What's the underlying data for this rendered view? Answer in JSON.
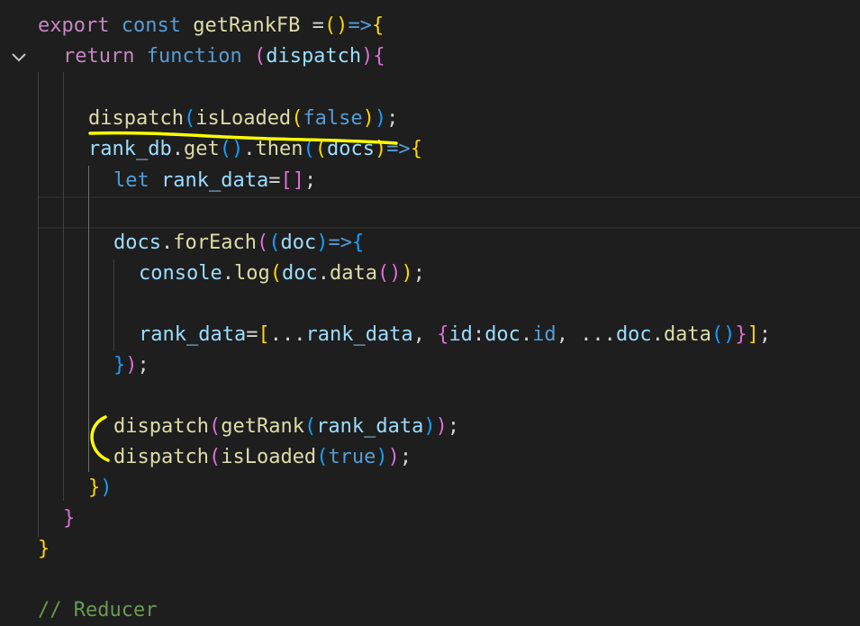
{
  "editor": {
    "lines": [
      {
        "tokens": [
          {
            "t": "export",
            "c": "kw"
          },
          {
            "t": " ",
            "c": "pun"
          },
          {
            "t": "const",
            "c": "kw2"
          },
          {
            "t": " ",
            "c": "pun"
          },
          {
            "t": "getRankFB",
            "c": "fn"
          },
          {
            "t": " =",
            "c": "pun"
          },
          {
            "t": "()",
            "c": "br1"
          },
          {
            "t": "=>",
            "c": "kw2"
          },
          {
            "t": "{",
            "c": "br1"
          }
        ]
      },
      {
        "tokens": [
          {
            "t": "return",
            "c": "kw"
          },
          {
            "t": " ",
            "c": "pun"
          },
          {
            "t": "function",
            "c": "kw2"
          },
          {
            "t": " ",
            "c": "pun"
          },
          {
            "t": "(",
            "c": "br2"
          },
          {
            "t": "dispatch",
            "c": "id"
          },
          {
            "t": ")",
            "c": "br2"
          },
          {
            "t": "{",
            "c": "br2"
          }
        ]
      },
      {
        "tokens": []
      },
      {
        "tokens": [
          {
            "t": "dispatch",
            "c": "fn"
          },
          {
            "t": "(",
            "c": "br3"
          },
          {
            "t": "isLoaded",
            "c": "fn"
          },
          {
            "t": "(",
            "c": "br1"
          },
          {
            "t": "false",
            "c": "kw2"
          },
          {
            "t": ")",
            "c": "br1"
          },
          {
            "t": ")",
            "c": "br3"
          },
          {
            "t": ";",
            "c": "pun"
          }
        ]
      },
      {
        "tokens": [
          {
            "t": "rank_db",
            "c": "id"
          },
          {
            "t": ".",
            "c": "pun"
          },
          {
            "t": "get",
            "c": "fn"
          },
          {
            "t": "()",
            "c": "br3"
          },
          {
            "t": ".",
            "c": "pun"
          },
          {
            "t": "then",
            "c": "fn"
          },
          {
            "t": "(",
            "c": "br3"
          },
          {
            "t": "(",
            "c": "br1"
          },
          {
            "t": "docs",
            "c": "id"
          },
          {
            "t": ")",
            "c": "br1"
          },
          {
            "t": "=>",
            "c": "kw2"
          },
          {
            "t": "{",
            "c": "br1"
          }
        ]
      },
      {
        "tokens": [
          {
            "t": "let",
            "c": "kw2"
          },
          {
            "t": " ",
            "c": "pun"
          },
          {
            "t": "rank_data",
            "c": "id"
          },
          {
            "t": "=",
            "c": "pun"
          },
          {
            "t": "[]",
            "c": "br2"
          },
          {
            "t": ";",
            "c": "pun"
          }
        ]
      },
      {
        "tokens": []
      },
      {
        "tokens": [
          {
            "t": "docs",
            "c": "id"
          },
          {
            "t": ".",
            "c": "pun"
          },
          {
            "t": "forEach",
            "c": "fn"
          },
          {
            "t": "(",
            "c": "br2"
          },
          {
            "t": "(",
            "c": "br3"
          },
          {
            "t": "doc",
            "c": "id"
          },
          {
            "t": ")",
            "c": "br3"
          },
          {
            "t": "=>",
            "c": "kw2"
          },
          {
            "t": "{",
            "c": "br3"
          }
        ]
      },
      {
        "tokens": [
          {
            "t": "console",
            "c": "id"
          },
          {
            "t": ".",
            "c": "pun"
          },
          {
            "t": "log",
            "c": "fn"
          },
          {
            "t": "(",
            "c": "br1"
          },
          {
            "t": "doc",
            "c": "id"
          },
          {
            "t": ".",
            "c": "pun"
          },
          {
            "t": "data",
            "c": "fn"
          },
          {
            "t": "()",
            "c": "br2"
          },
          {
            "t": ")",
            "c": "br1"
          },
          {
            "t": ";",
            "c": "pun"
          }
        ]
      },
      {
        "tokens": []
      },
      {
        "tokens": [
          {
            "t": "rank_data",
            "c": "id"
          },
          {
            "t": "=",
            "c": "pun"
          },
          {
            "t": "[",
            "c": "br1"
          },
          {
            "t": "...",
            "c": "pun"
          },
          {
            "t": "rank_data",
            "c": "id"
          },
          {
            "t": ", ",
            "c": "pun"
          },
          {
            "t": "{",
            "c": "br2"
          },
          {
            "t": "id",
            "c": "id"
          },
          {
            "t": ":",
            "c": "pun"
          },
          {
            "t": "doc",
            "c": "id"
          },
          {
            "t": ".",
            "c": "pun"
          },
          {
            "t": "id",
            "c": "kw2"
          },
          {
            "t": ", ",
            "c": "pun"
          },
          {
            "t": "...",
            "c": "pun"
          },
          {
            "t": "doc",
            "c": "id"
          },
          {
            "t": ".",
            "c": "pun"
          },
          {
            "t": "data",
            "c": "fn"
          },
          {
            "t": "()",
            "c": "br3"
          },
          {
            "t": "}",
            "c": "br2"
          },
          {
            "t": "]",
            "c": "br1"
          },
          {
            "t": ";",
            "c": "pun"
          }
        ]
      },
      {
        "tokens": [
          {
            "t": "}",
            "c": "br3"
          },
          {
            "t": ")",
            "c": "br2"
          },
          {
            "t": ";",
            "c": "pun"
          }
        ]
      },
      {
        "tokens": []
      },
      {
        "tokens": [
          {
            "t": "dispatch",
            "c": "fn"
          },
          {
            "t": "(",
            "c": "br2"
          },
          {
            "t": "getRank",
            "c": "fn"
          },
          {
            "t": "(",
            "c": "br3"
          },
          {
            "t": "rank_data",
            "c": "id"
          },
          {
            "t": ")",
            "c": "br3"
          },
          {
            "t": ")",
            "c": "br2"
          },
          {
            "t": ";",
            "c": "pun"
          }
        ]
      },
      {
        "tokens": [
          {
            "t": "dispatch",
            "c": "fn"
          },
          {
            "t": "(",
            "c": "br2"
          },
          {
            "t": "isLoaded",
            "c": "fn"
          },
          {
            "t": "(",
            "c": "br3"
          },
          {
            "t": "true",
            "c": "kw2"
          },
          {
            "t": ")",
            "c": "br3"
          },
          {
            "t": ")",
            "c": "br2"
          },
          {
            "t": ";",
            "c": "pun"
          }
        ]
      },
      {
        "tokens": [
          {
            "t": "}",
            "c": "br1"
          },
          {
            "t": ")",
            "c": "br3"
          }
        ]
      },
      {
        "tokens": [
          {
            "t": "}",
            "c": "br2"
          }
        ]
      },
      {
        "tokens": [
          {
            "t": "}",
            "c": "br1"
          }
        ]
      },
      {
        "tokens": []
      },
      {
        "tokens": [
          {
            "t": "// Reducer",
            "c": "cmt"
          }
        ]
      }
    ]
  },
  "colors": {
    "background": "#1e1e1e",
    "highlighter": "#ffff00"
  },
  "icons": {
    "fold": "chevron-down-icon"
  }
}
